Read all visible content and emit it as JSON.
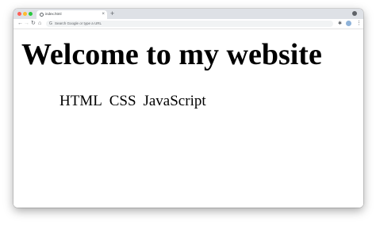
{
  "browser": {
    "tab": {
      "title": "index.html",
      "close": "×"
    },
    "new_tab": "+",
    "address_bar": {
      "placeholder": "Search Google or type a URL",
      "icon": "G"
    },
    "nav": {
      "back": "←",
      "forward": "→",
      "reload": "↻",
      "home": "⌂"
    },
    "menu": "⋮",
    "extensions": "✱"
  },
  "page": {
    "heading": "Welcome to my website",
    "nav_items": [
      "HTML",
      "CSS",
      "JavaScript"
    ]
  },
  "colors": {
    "tabstrip": "#dee1e6",
    "close_dot": "#ff5f57",
    "minimize_dot": "#febc2e",
    "zoom_dot": "#28c840"
  }
}
